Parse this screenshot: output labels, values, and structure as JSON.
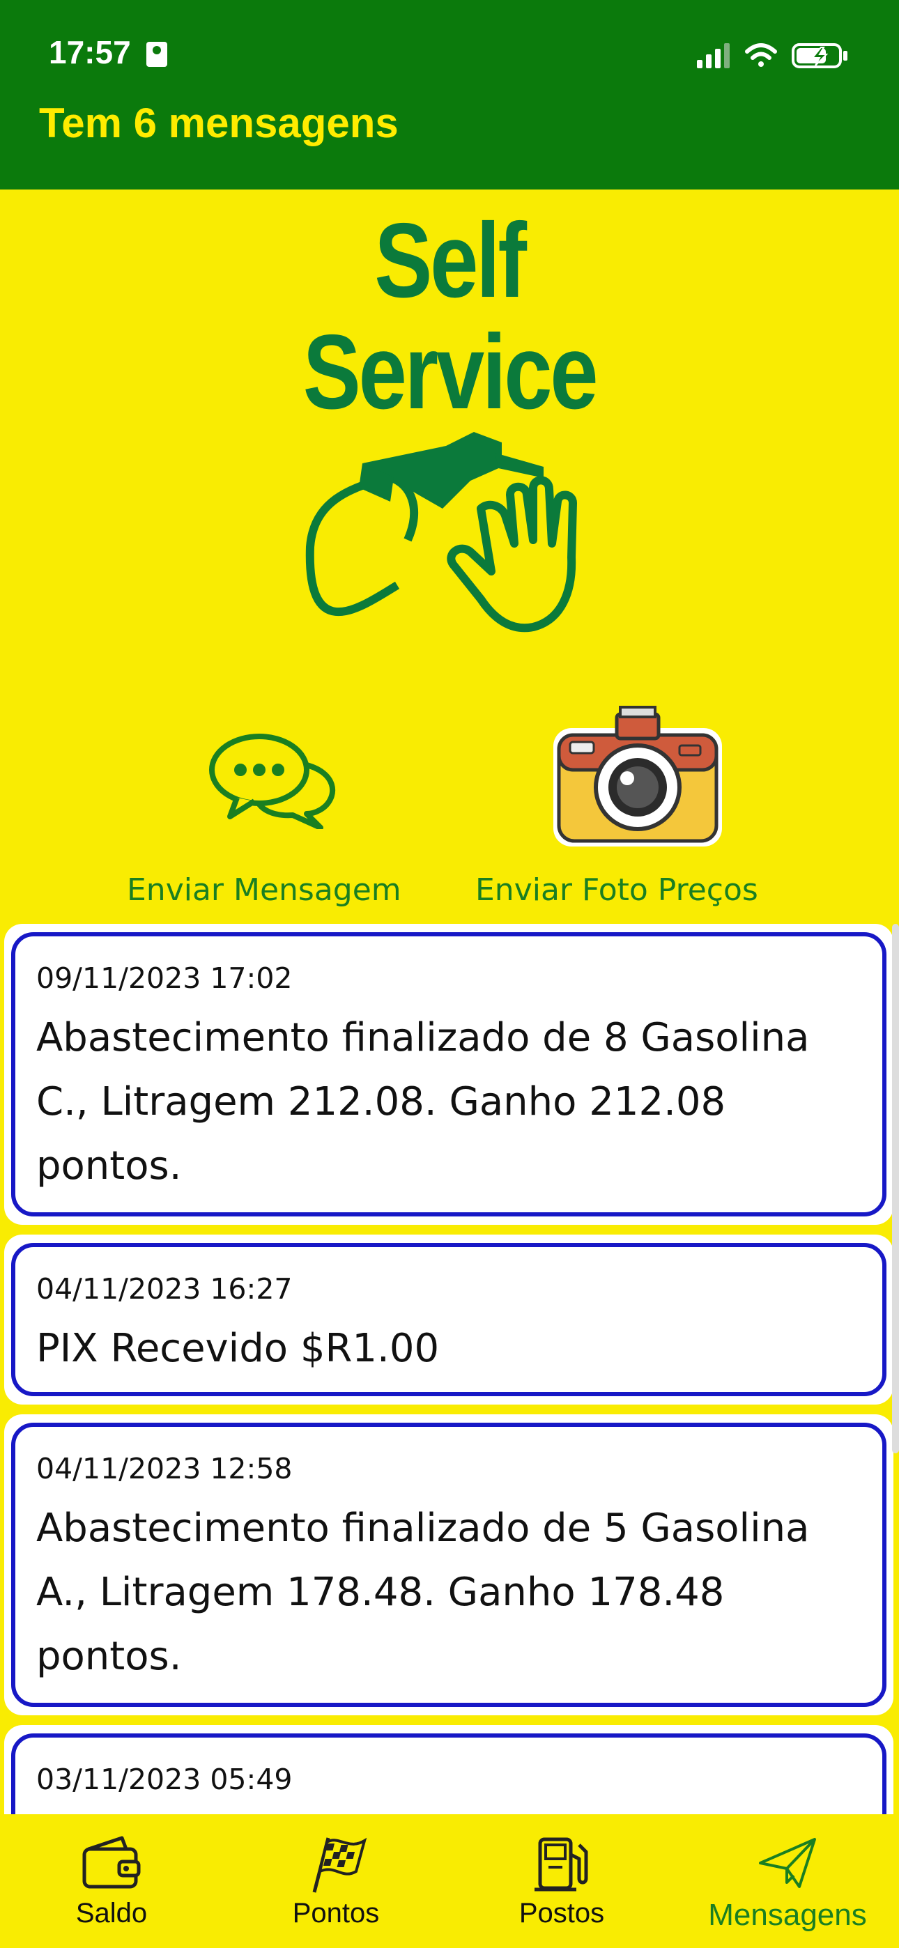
{
  "status_bar": {
    "time": "17:57"
  },
  "header": {
    "title": "Tem 6 mensagens"
  },
  "logo": {
    "line1": "Self",
    "line2": "Service"
  },
  "actions": {
    "send_message_label": "Enviar Mensagem",
    "send_photo_label": "Enviar Foto Preços"
  },
  "messages": [
    {
      "date": "09/11/2023 17:02",
      "text": "Abastecimento finalizado de 8 Gasolina C., Litragem 212.08. Ganho 212.08 pontos."
    },
    {
      "date": "04/11/2023 16:27",
      "text": "PIX Recevido $R1.00"
    },
    {
      "date": "04/11/2023 12:58",
      "text": "Abastecimento finalizado de 5 Gasolina A., Litragem 178.48. Ganho 178.48 pontos."
    },
    {
      "date": "03/11/2023 05:49",
      "text": ""
    }
  ],
  "nav": {
    "items": [
      {
        "label": "Saldo",
        "icon": "wallet-icon"
      },
      {
        "label": "Pontos",
        "icon": "checkered-flag-icon"
      },
      {
        "label": "Postos",
        "icon": "fuel-pump-icon"
      },
      {
        "label": "Mensagens",
        "icon": "paper-plane-icon",
        "active": true
      }
    ]
  },
  "colors": {
    "header_green": "#0b7a0c",
    "background_yellow": "#f9ec02",
    "title_yellow": "#ffec00",
    "card_border_blue": "#1718c6",
    "label_green": "#1a7f21"
  }
}
